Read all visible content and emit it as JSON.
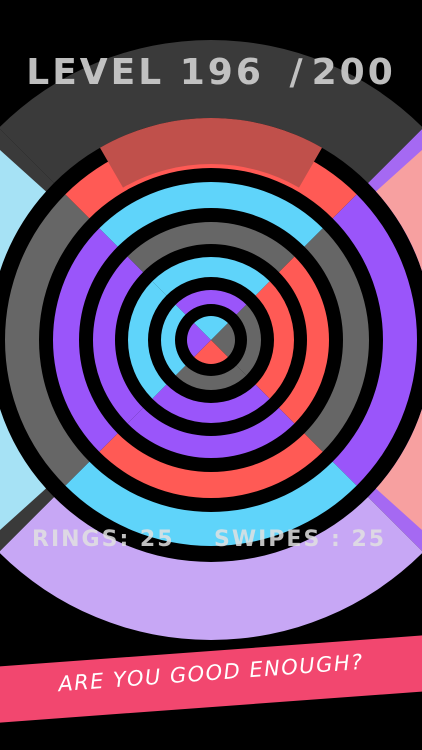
{
  "hud": {
    "level_label": "LEVEL",
    "level_current": "196",
    "level_separator": "/",
    "level_total": "200",
    "rings_label": "RINGS:",
    "rings_value": "25",
    "swipes_label": "SWIPES :",
    "swipes_value": "25"
  },
  "banner": {
    "text": "ARE YOU GOOD ENOUGH?"
  },
  "colors": {
    "background": "#000000",
    "gray": "#666666",
    "red": "#ff5a55",
    "cyan": "#5fd4fa",
    "purple": "#9a55fa",
    "outer_dark": "#3a3a3a",
    "outer_red": "#c0504b",
    "outer_purple": "#a569f2",
    "outer_lilac": "#c7a7f5",
    "outer_pink": "#f7a0a0",
    "outer_cyan": "#a6e2f5",
    "banner": "#f2476f"
  },
  "rings": [
    {
      "name": "core",
      "quadrants": {
        "top": "cyan",
        "right": "gray",
        "bottom": "red",
        "left": "purple"
      }
    },
    {
      "name": "ring-1",
      "quadrants": {
        "top": "purple",
        "right": "gray",
        "bottom": "gray",
        "left": "cyan"
      }
    },
    {
      "name": "ring-2",
      "quadrants": {
        "top": "cyan",
        "right": "red",
        "bottom": "purple",
        "left": "cyan"
      }
    },
    {
      "name": "ring-3",
      "quadrants": {
        "top": "gray",
        "right": "red",
        "bottom": "purple",
        "left": "purple"
      }
    },
    {
      "name": "ring-4",
      "quadrants": {
        "top": "cyan",
        "right": "gray",
        "bottom": "red",
        "left": "purple"
      }
    },
    {
      "name": "ring-5",
      "quadrants": {
        "top": "red",
        "right": "purple",
        "bottom": "cyan",
        "left": "gray"
      }
    },
    {
      "name": "ring-outer",
      "quadrants": {
        "top": "outer_dark",
        "right": "outer_purple",
        "bottom": "outer_lilac",
        "left": "outer_dark"
      }
    }
  ]
}
